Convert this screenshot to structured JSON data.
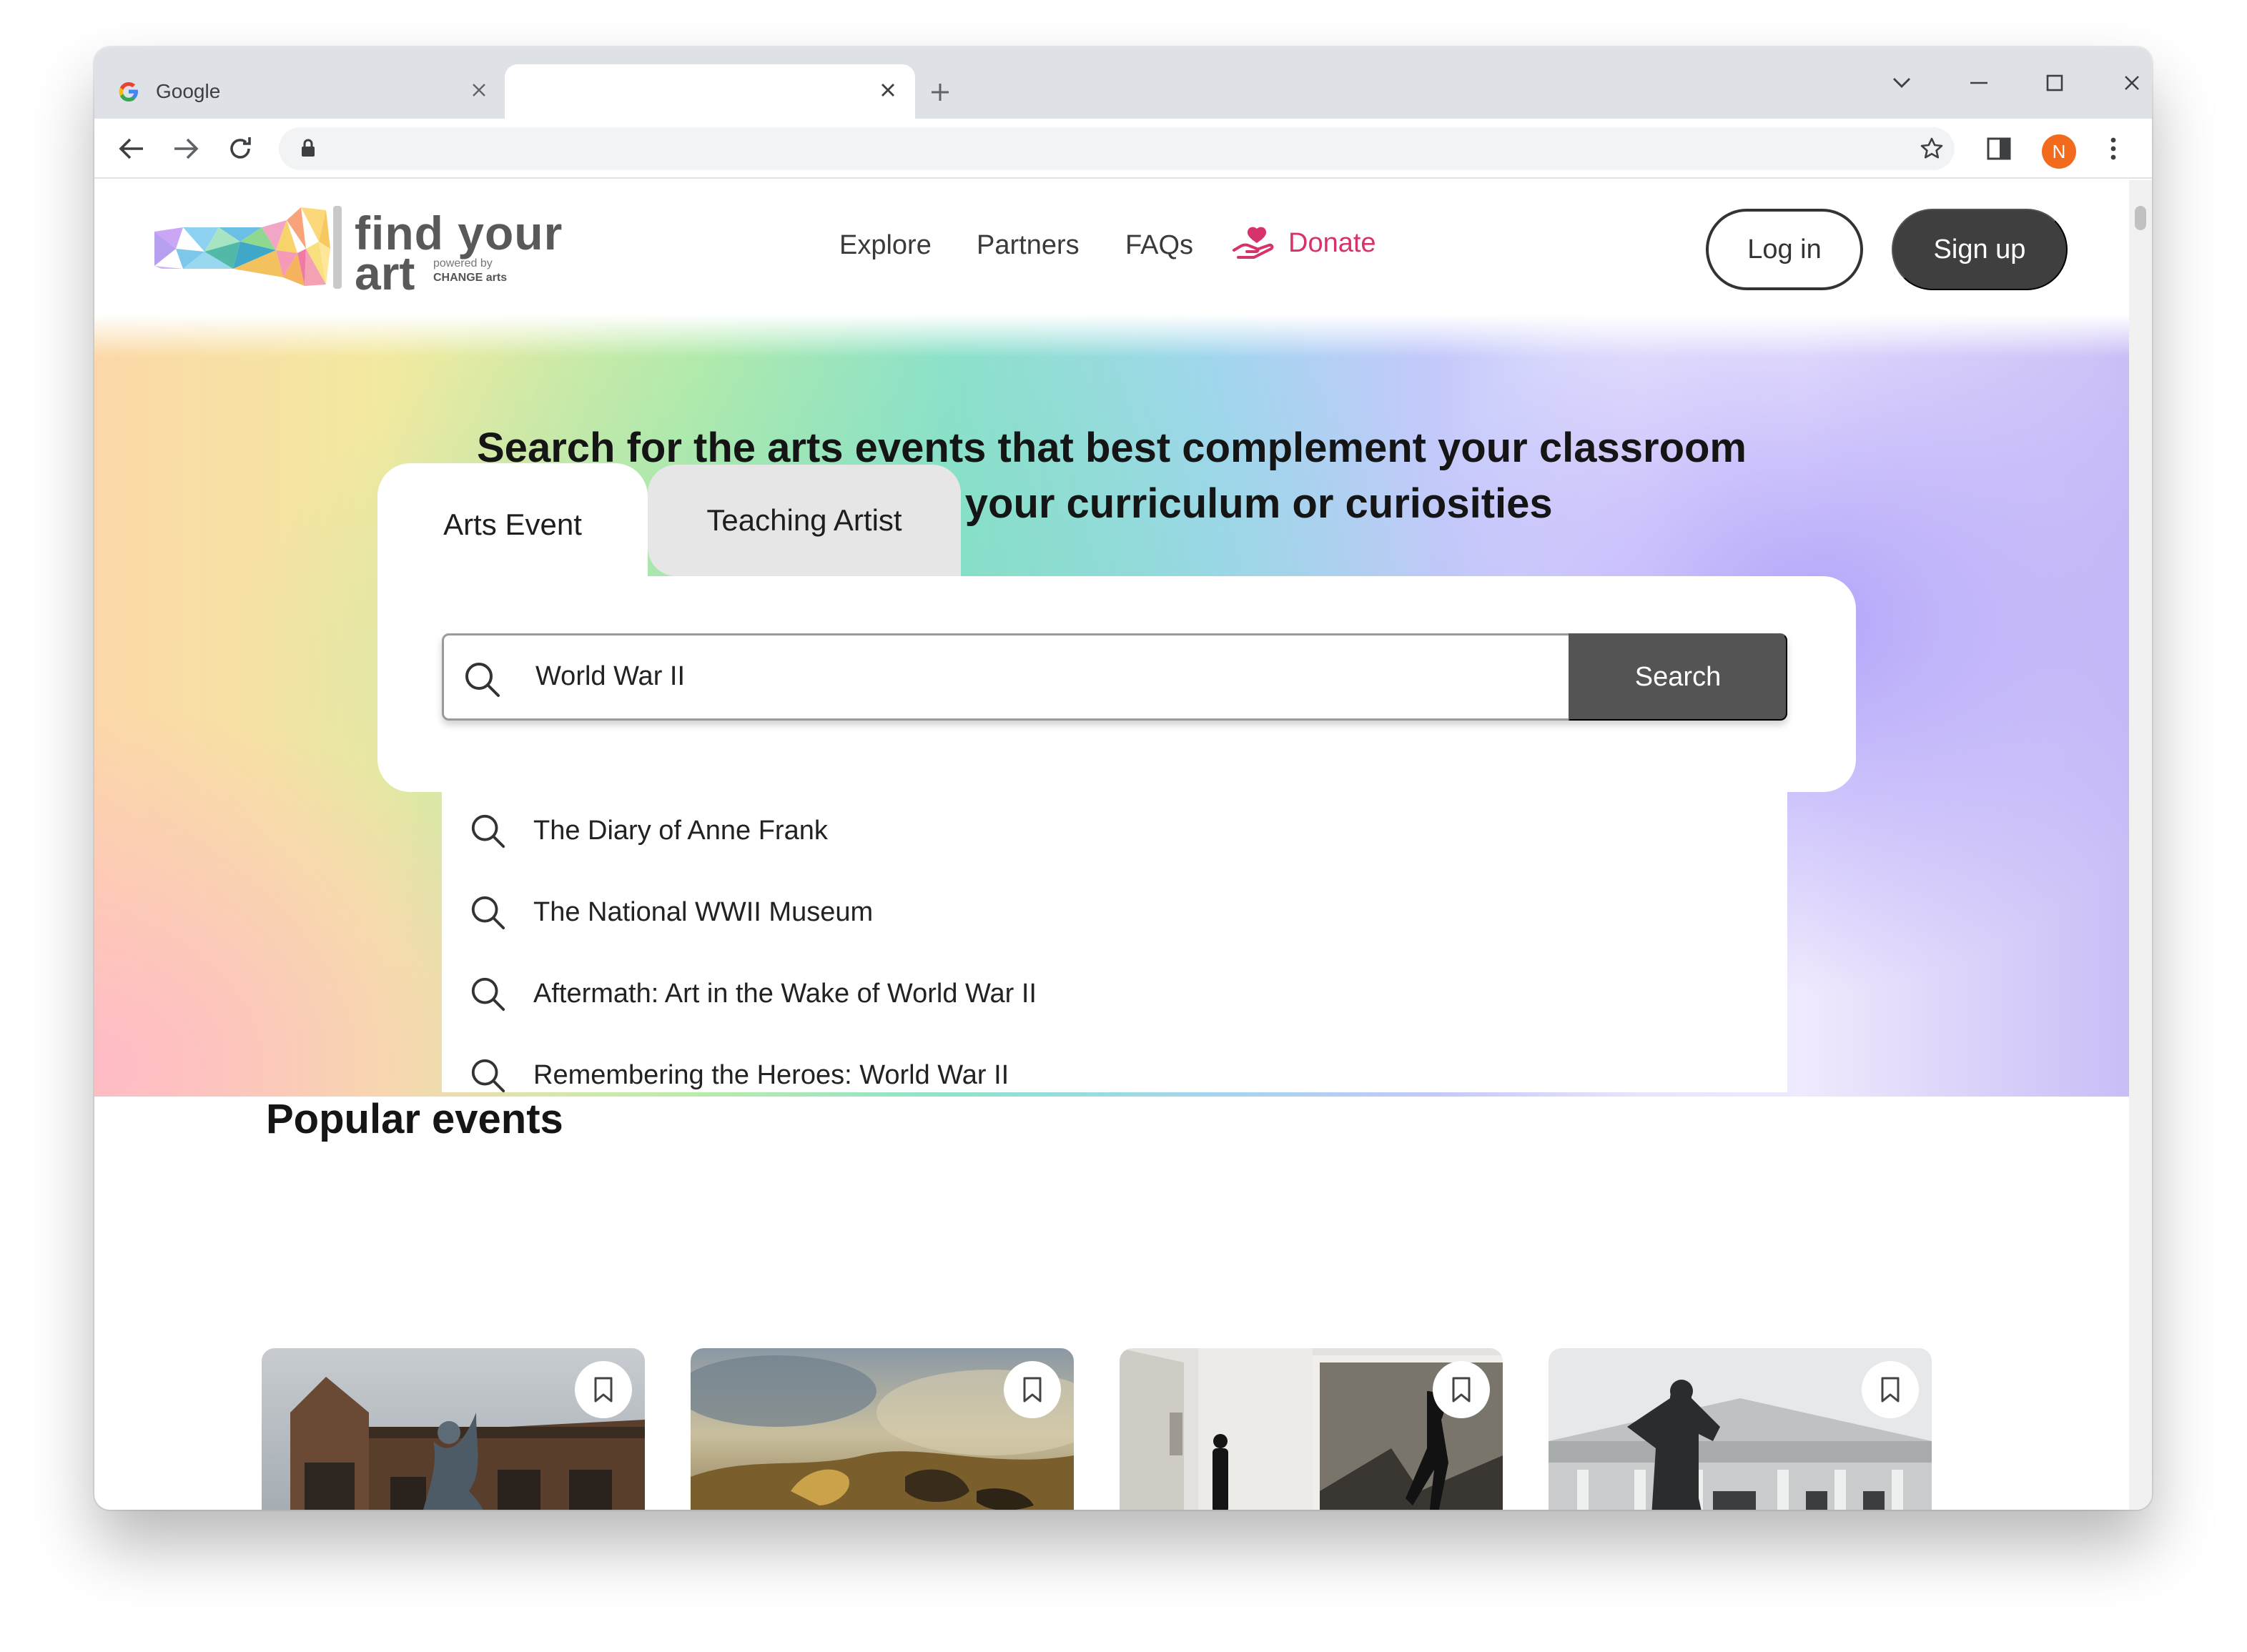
{
  "browser": {
    "tabs": [
      {
        "title": "Google",
        "active": false
      },
      {
        "title": "",
        "active": true
      }
    ],
    "profile_initial": "N"
  },
  "site": {
    "logo": {
      "line1": "find your",
      "line2": "art",
      "powered_by": "powered by",
      "brand": "CHANGE arts"
    },
    "nav": {
      "explore": "Explore",
      "partners": "Partners",
      "faqs": "FAQs",
      "donate": "Donate"
    },
    "login_label": "Log in",
    "signup_label": "Sign up",
    "accent_color": "#d6336c"
  },
  "hero": {
    "headline_line1": "Search for the arts events that best complement your classroom",
    "headline_line2": "or community, your curriculum or curiosities"
  },
  "search": {
    "tabs": {
      "arts_event": "Arts Event",
      "teaching_artist": "Teaching Artist"
    },
    "query": "World War II",
    "button_label": "Search",
    "suggestions": [
      "The Diary of Anne Frank",
      "The National WWII Museum",
      "Aftermath: Art in the Wake of World War II",
      "Remembering the Heroes: World War II"
    ]
  },
  "popular": {
    "heading": "Popular events",
    "events": [
      {
        "image": "gothic-building-angel-statue"
      },
      {
        "image": "battle-painting"
      },
      {
        "image": "gallery-visitor"
      },
      {
        "image": "statue-before-theatre"
      }
    ]
  }
}
